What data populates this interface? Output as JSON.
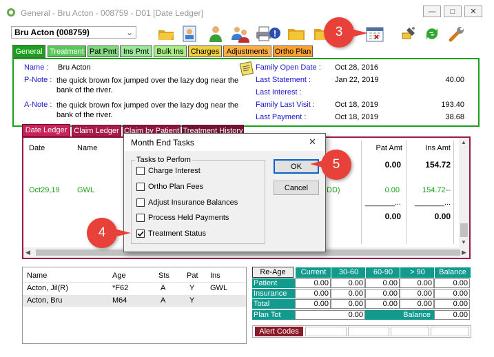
{
  "window": {
    "title": "General - Bru Acton - 008759 - D01 [Date Ledger]",
    "minimize": "—",
    "maximize": "□",
    "close": "✕"
  },
  "patient_select": {
    "value": "Bru Acton (008759)"
  },
  "main_tabs": [
    {
      "label": "General",
      "color": "#1aa01a",
      "text": "#ffffff"
    },
    {
      "label": "Treatment",
      "color": "#58c858",
      "text": "#ffffff"
    },
    {
      "label": "Pat Pmt",
      "color": "#7ed87e",
      "text": "#000000"
    },
    {
      "label": "Ins Pmt",
      "color": "#98e898",
      "text": "#000000"
    },
    {
      "label": "Bulk Ins",
      "color": "#a8ec84",
      "text": "#000000"
    },
    {
      "label": "Charges",
      "color": "#f0d040",
      "text": "#000000"
    },
    {
      "label": "Adjustments",
      "color": "#ffb040",
      "text": "#000000"
    },
    {
      "label": "Ortho Plan",
      "color": "#ffa030",
      "text": "#000000"
    }
  ],
  "info": {
    "name_label": "Name :",
    "name_value": "Bru Acton",
    "pnote_label": "P-Note :",
    "pnote_value": "the quick brown fox jumped over the lazy dog near the bank of the river.",
    "anote_label": "A-Note :",
    "anote_value": "the quick brown fox jumped over the lazy dog near the bank of the river.",
    "family_open_label": "Family Open Date :",
    "family_open_value": "Oct 28, 2016",
    "last_statement_label": "Last Statement :",
    "last_statement_date": "Jan 22, 2019",
    "last_statement_amt": "40.00",
    "last_interest_label": "Last Interest :",
    "family_last_visit_label": "Family Last Visit :",
    "family_last_visit_date": "Oct 18, 2019",
    "family_last_visit_amt": "193.40",
    "last_payment_label": "Last Payment :",
    "last_payment_date": "Oct 18, 2019",
    "last_payment_amt": "38.68"
  },
  "ledger_tabs": [
    "Date Ledger",
    "Claim Ledger",
    "Claim by Patient",
    "Treatment History"
  ],
  "ledger": {
    "col_date": "Date",
    "col_name": "Name",
    "col_pat_amt": "Pat Amt",
    "col_ins_amt": "Ins Amt",
    "total_pat": "0.00",
    "total_ins": "154.72",
    "row_date": "Oct29,19",
    "row_name": "GWL",
    "row_frag": "DD)",
    "row_pat": "0.00",
    "row_ins": "154.72--",
    "dash_pat": "_______...",
    "dash_ins": "_______...",
    "sum_pat": "0.00",
    "sum_ins": "0.00"
  },
  "family": {
    "headers": [
      "Name",
      "Age",
      "Sts",
      "Pat",
      "Ins"
    ],
    "rows": [
      [
        "Acton, Jil(R)",
        "*F62",
        "A",
        "Y",
        "GWL"
      ],
      [
        "Acton, Bru",
        "M64",
        "A",
        "Y",
        ""
      ]
    ]
  },
  "aging": {
    "reage_label": "Re-Age",
    "headers": [
      "Current",
      "30-60",
      "60-90",
      "> 90",
      "Balance"
    ],
    "rows": [
      {
        "label": "Patient",
        "values": [
          "0.00",
          "0.00",
          "0.00",
          "0.00",
          "0.00"
        ]
      },
      {
        "label": "Insurance",
        "values": [
          "0.00",
          "0.00",
          "0.00",
          "0.00",
          "0.00"
        ]
      },
      {
        "label": "Total",
        "values": [
          "0.00",
          "0.00",
          "0.00",
          "0.00",
          "0.00"
        ]
      }
    ],
    "plan_tot_label": "Plan Tot",
    "plan_tot_value": "0.00",
    "balance_label": "Balance",
    "balance_value": "0.00",
    "alert_codes_label": "Alert Codes"
  },
  "dialog": {
    "title": "Month End Tasks",
    "close": "✕",
    "group_label": "Tasks to Perfom",
    "tasks": [
      {
        "label": "Charge Interest",
        "checked": false
      },
      {
        "label": "Ortho Plan Fees",
        "checked": false
      },
      {
        "label": "Adjust Insurance Balances",
        "checked": false
      },
      {
        "label": "Process Held Payments",
        "checked": false
      },
      {
        "label": "Treatment Status",
        "checked": true
      }
    ],
    "ok_label": "OK",
    "cancel_label": "Cancel"
  },
  "callouts": {
    "c3": "3",
    "c4": "4",
    "c5": "5"
  },
  "toolbar_icons": [
    "open-folder-icon",
    "patient-card-icon",
    "person-icon",
    "family-icon",
    "printer-icon",
    "info-icon",
    "folder-icon",
    "folder-icon",
    "calendar-icon",
    "satellite-icon",
    "refresh-icon",
    "wrench-icon"
  ]
}
